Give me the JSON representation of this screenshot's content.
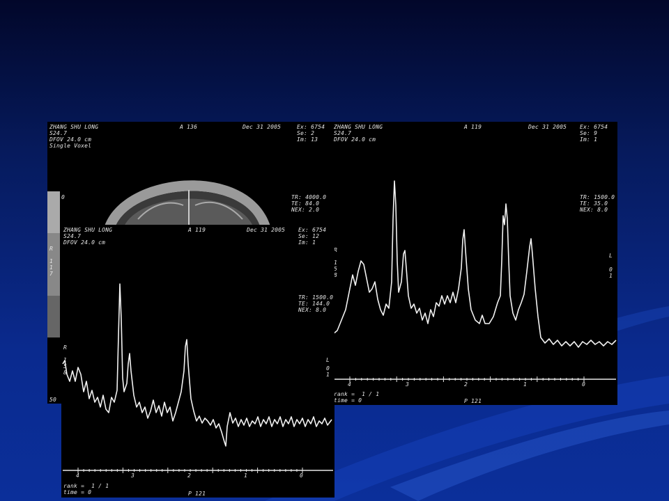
{
  "panel_back": {
    "patient": "ZHANG SHU LONG",
    "slice": "S24.7",
    "fov": "DFOV 24.0 cm",
    "mode": "Single Voxel",
    "loc": "A 136",
    "date": "Dec 31 2005",
    "ex": "Ex: 6754",
    "se": "Se: 2",
    "im": "Im: 13",
    "tr": "TR: 4000.0",
    "te": "TE: 84.0",
    "nex": "NEX: 2.0",
    "zero": "0",
    "side_r": "R",
    "side_vals": "1\n1\n7",
    "bottom_num": "50"
  },
  "panel_right": {
    "patient": "ZHANG SHU LONG",
    "slice": "S24.7",
    "fov": "DFOV 24.0 cm",
    "loc": "A 119",
    "date": "Dec 31 2005",
    "ex": "Ex: 6754",
    "se": "Se: 9",
    "im": "Im: 1",
    "tr": "TR: 1500.0",
    "te": "TE: 35.0",
    "nex": "NEX: 8.0",
    "left_r": "R",
    "left_vals": "1\n5\n8",
    "right_l": "L",
    "right_vals": "0\n1",
    "rank": "rank =  1 / 1",
    "time": "time = 0",
    "page": "P 121",
    "axis_ticks": [
      "4",
      "3",
      "2",
      "1",
      "0"
    ]
  },
  "panel_front": {
    "patient": "ZHANG SHU LONG",
    "slice": "S24.7",
    "fov": "DFOV 24.0 cm",
    "loc": "A 119",
    "date": "Dec 31 2005",
    "ex": "Ex: 6754",
    "se": "Se: 12",
    "im": "Im: 1",
    "tr": "TR: 1500.0",
    "te": "TE: 144.0",
    "nex": "NEX: 8.0",
    "left_r": "R",
    "left_vals": "1\n5\n8",
    "right_l": "L",
    "right_vals": "0\n1",
    "rank": "rank =  1 / 1",
    "time": "time = 0",
    "page": "P 121",
    "axis_ticks": [
      "4",
      "3",
      "2",
      "1",
      "0"
    ]
  }
}
